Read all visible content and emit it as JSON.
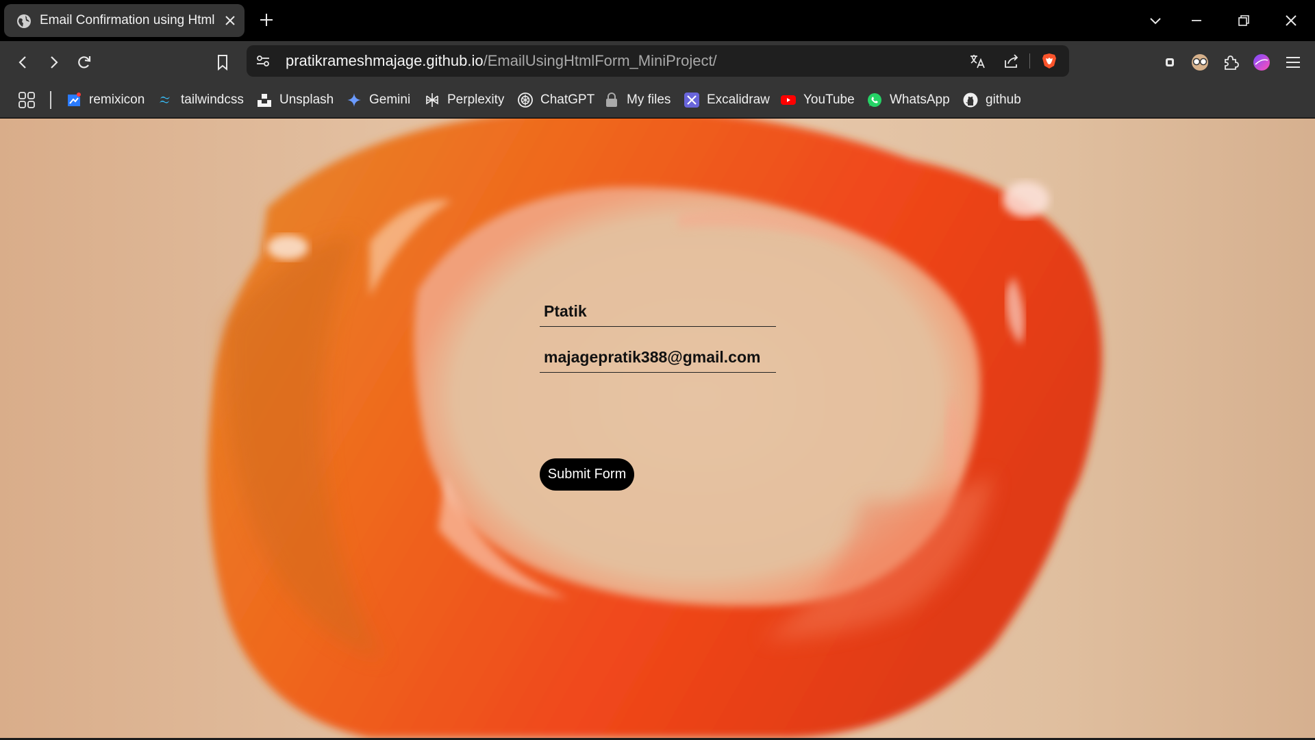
{
  "tab": {
    "title": "Email Confirmation using Html"
  },
  "address_bar": {
    "host": "pratikrameshmajage.github.io",
    "path": "/EmailUsingHtmlForm_MiniProject/"
  },
  "bookmarks": [
    {
      "label": "remixicon",
      "icon": "remixicon-icon"
    },
    {
      "label": "tailwindcss",
      "icon": "tailwindcss-icon"
    },
    {
      "label": "Unsplash",
      "icon": "unsplash-icon"
    },
    {
      "label": "Gemini",
      "icon": "gemini-icon"
    },
    {
      "label": "Perplexity",
      "icon": "perplexity-icon"
    },
    {
      "label": "ChatGPT",
      "icon": "chatgpt-icon"
    },
    {
      "label": "My files",
      "icon": "lock-icon"
    },
    {
      "label": "Excalidraw",
      "icon": "excalidraw-icon"
    },
    {
      "label": "YouTube",
      "icon": "youtube-icon"
    },
    {
      "label": "WhatsApp",
      "icon": "whatsapp-icon"
    },
    {
      "label": "github",
      "icon": "github-icon"
    }
  ],
  "form": {
    "name_value": "Ptatik",
    "email_value": "majagepratik388@gmail.com",
    "submit_label": "Submit Form"
  },
  "colors": {
    "accent_orange": "#e85a1a",
    "page_background": "#e3c2a4",
    "button_bg": "#000000"
  }
}
